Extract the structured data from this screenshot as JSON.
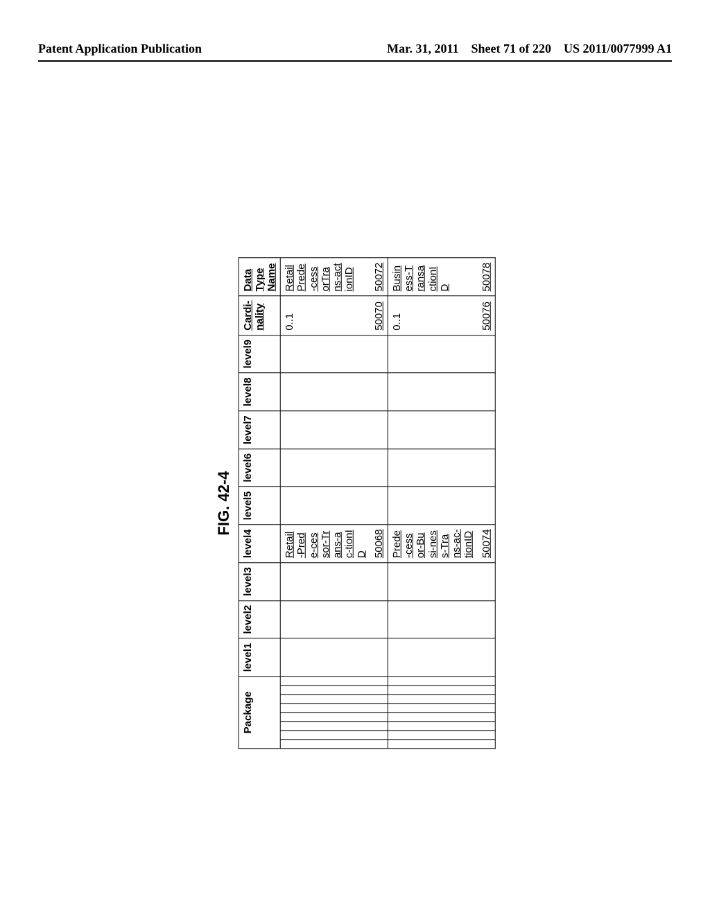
{
  "header": {
    "left": "Patent Application Publication",
    "date": "Mar. 31, 2011",
    "sheet": "Sheet 71 of 220",
    "pubno": "US 2011/0077999 A1"
  },
  "figure": {
    "title": "FIG. 42-4"
  },
  "columns": {
    "package": "Package",
    "l1": "level1",
    "l2": "level2",
    "l3": "level3",
    "l4": "level4",
    "l5": "level5",
    "l6": "level6",
    "l7": "level7",
    "l8": "level8",
    "l9": "level9",
    "card": "Cardi-nality",
    "dtn": "Data Type Name"
  },
  "rows": [
    {
      "level4": "Retail-Prede-cessor-Trans-ac-tionID",
      "level4_ref": "50068",
      "card": "0..1",
      "card_ref": "50070",
      "dtn": "RetailPrede-cessorTrans-actionID",
      "dtn_ref": "50072"
    },
    {
      "level4": "Prede-cessor-Busi-ness-Trans-ac-tionID",
      "level4_ref": "50074",
      "card": "0..1",
      "card_ref": "50076",
      "dtn": "Business-TransactionID",
      "dtn_ref": "50078"
    }
  ]
}
